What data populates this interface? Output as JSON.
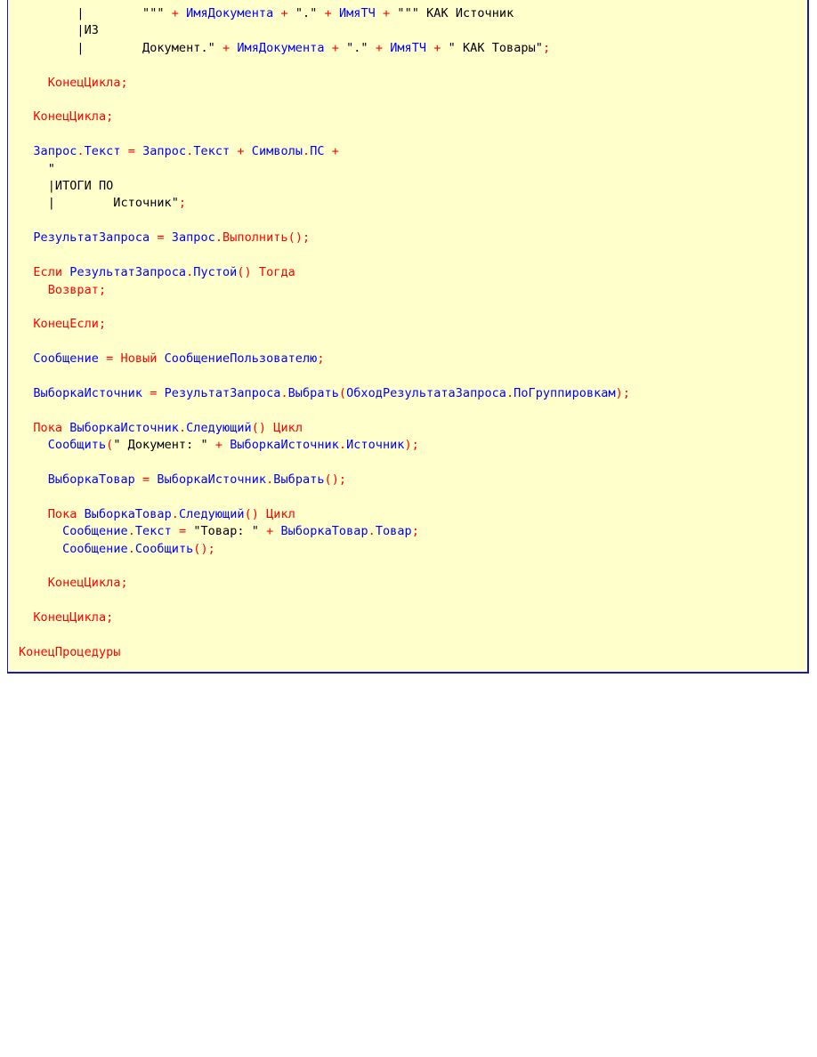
{
  "colors": {
    "background": "#ffffcc",
    "border": "#1a1ab8",
    "identifier": "#0000ff",
    "keyword": "#ff0000",
    "operator": "#ff0000",
    "string": "#000000"
  },
  "code_lines": [
    [
      [
        "ws",
        "        |        "
      ],
      [
        "str",
        "\"\"\""
      ],
      [
        "ws",
        " "
      ],
      [
        "op",
        "+"
      ],
      [
        "ws",
        " "
      ],
      [
        "id",
        "ИмяДокумента"
      ],
      [
        "ws",
        " "
      ],
      [
        "op",
        "+"
      ],
      [
        "ws",
        " "
      ],
      [
        "str",
        "\".\""
      ],
      [
        "ws",
        " "
      ],
      [
        "op",
        "+"
      ],
      [
        "ws",
        " "
      ],
      [
        "id",
        "ИмяТЧ"
      ],
      [
        "ws",
        " "
      ],
      [
        "op",
        "+"
      ],
      [
        "ws",
        " "
      ],
      [
        "str",
        "\"\"\" КАК Источник"
      ]
    ],
    [
      [
        "str",
        "        |ИЗ"
      ]
    ],
    [
      [
        "str",
        "        |        Документ.\""
      ],
      [
        "ws",
        " "
      ],
      [
        "op",
        "+"
      ],
      [
        "ws",
        " "
      ],
      [
        "id",
        "ИмяДокумента"
      ],
      [
        "ws",
        " "
      ],
      [
        "op",
        "+"
      ],
      [
        "ws",
        " "
      ],
      [
        "str",
        "\".\""
      ],
      [
        "ws",
        " "
      ],
      [
        "op",
        "+"
      ],
      [
        "ws",
        " "
      ],
      [
        "id",
        "ИмяТЧ"
      ],
      [
        "ws",
        " "
      ],
      [
        "op",
        "+"
      ],
      [
        "ws",
        " "
      ],
      [
        "str",
        "\" КАК Товары\""
      ],
      [
        "op",
        ";"
      ]
    ],
    [],
    [
      [
        "ws",
        "    "
      ],
      [
        "kw",
        "КонецЦикла"
      ],
      [
        "op",
        ";"
      ]
    ],
    [],
    [
      [
        "ws",
        "  "
      ],
      [
        "kw",
        "КонецЦикла"
      ],
      [
        "op",
        ";"
      ]
    ],
    [],
    [
      [
        "ws",
        "  "
      ],
      [
        "id",
        "Запрос"
      ],
      [
        "op",
        "."
      ],
      [
        "id",
        "Текст"
      ],
      [
        "ws",
        " "
      ],
      [
        "op",
        "="
      ],
      [
        "ws",
        " "
      ],
      [
        "id",
        "Запрос"
      ],
      [
        "op",
        "."
      ],
      [
        "id",
        "Текст"
      ],
      [
        "ws",
        " "
      ],
      [
        "op",
        "+"
      ],
      [
        "ws",
        " "
      ],
      [
        "id",
        "Символы"
      ],
      [
        "op",
        "."
      ],
      [
        "id",
        "ПС"
      ],
      [
        "ws",
        " "
      ],
      [
        "op",
        "+"
      ]
    ],
    [
      [
        "str",
        "    \""
      ]
    ],
    [
      [
        "str",
        "    |ИТОГИ ПО"
      ]
    ],
    [
      [
        "str",
        "    |        Источник\""
      ],
      [
        "op",
        ";"
      ]
    ],
    [],
    [
      [
        "ws",
        "  "
      ],
      [
        "id",
        "РезультатЗапроса"
      ],
      [
        "ws",
        " "
      ],
      [
        "op",
        "="
      ],
      [
        "ws",
        " "
      ],
      [
        "id",
        "Запрос"
      ],
      [
        "op",
        "."
      ],
      [
        "kw",
        "Выполнить"
      ],
      [
        "op",
        "();"
      ]
    ],
    [],
    [
      [
        "ws",
        "  "
      ],
      [
        "kw",
        "Если"
      ],
      [
        "ws",
        " "
      ],
      [
        "id",
        "РезультатЗапроса"
      ],
      [
        "op",
        "."
      ],
      [
        "id",
        "Пустой"
      ],
      [
        "op",
        "()"
      ],
      [
        "ws",
        " "
      ],
      [
        "kw",
        "Тогда"
      ]
    ],
    [
      [
        "ws",
        "    "
      ],
      [
        "kw",
        "Возврат"
      ],
      [
        "op",
        ";"
      ]
    ],
    [],
    [
      [
        "ws",
        "  "
      ],
      [
        "kw",
        "КонецЕсли"
      ],
      [
        "op",
        ";"
      ]
    ],
    [],
    [
      [
        "ws",
        "  "
      ],
      [
        "id",
        "Сообщение"
      ],
      [
        "ws",
        " "
      ],
      [
        "op",
        "="
      ],
      [
        "ws",
        " "
      ],
      [
        "kw",
        "Новый"
      ],
      [
        "ws",
        " "
      ],
      [
        "id",
        "СообщениеПользователю"
      ],
      [
        "op",
        ";"
      ]
    ],
    [],
    [
      [
        "ws",
        "  "
      ],
      [
        "id",
        "ВыборкаИсточник"
      ],
      [
        "ws",
        " "
      ],
      [
        "op",
        "="
      ],
      [
        "ws",
        " "
      ],
      [
        "id",
        "РезультатЗапроса"
      ],
      [
        "op",
        "."
      ],
      [
        "id",
        "Выбрать"
      ],
      [
        "op",
        "("
      ],
      [
        "id",
        "ОбходРезультатаЗапроса"
      ],
      [
        "op",
        "."
      ],
      [
        "id",
        "ПоГруппировкам"
      ],
      [
        "op",
        ");"
      ]
    ],
    [],
    [
      [
        "ws",
        "  "
      ],
      [
        "kw",
        "Пока"
      ],
      [
        "ws",
        " "
      ],
      [
        "id",
        "ВыборкаИсточник"
      ],
      [
        "op",
        "."
      ],
      [
        "id",
        "Следующий"
      ],
      [
        "op",
        "()"
      ],
      [
        "ws",
        " "
      ],
      [
        "kw",
        "Цикл"
      ]
    ],
    [
      [
        "ws",
        "    "
      ],
      [
        "id",
        "Сообщить"
      ],
      [
        "op",
        "("
      ],
      [
        "str",
        "\" Документ: \""
      ],
      [
        "ws",
        " "
      ],
      [
        "op",
        "+"
      ],
      [
        "ws",
        " "
      ],
      [
        "id",
        "ВыборкаИсточник"
      ],
      [
        "op",
        "."
      ],
      [
        "id",
        "Источник"
      ],
      [
        "op",
        ");"
      ]
    ],
    [],
    [
      [
        "ws",
        "    "
      ],
      [
        "id",
        "ВыборкаТовар"
      ],
      [
        "ws",
        " "
      ],
      [
        "op",
        "="
      ],
      [
        "ws",
        " "
      ],
      [
        "id",
        "ВыборкаИсточник"
      ],
      [
        "op",
        "."
      ],
      [
        "id",
        "Выбрать"
      ],
      [
        "op",
        "();"
      ]
    ],
    [],
    [
      [
        "ws",
        "    "
      ],
      [
        "kw",
        "Пока"
      ],
      [
        "ws",
        " "
      ],
      [
        "id",
        "ВыборкаТовар"
      ],
      [
        "op",
        "."
      ],
      [
        "id",
        "Следующий"
      ],
      [
        "op",
        "()"
      ],
      [
        "ws",
        " "
      ],
      [
        "kw",
        "Цикл"
      ]
    ],
    [
      [
        "ws",
        "      "
      ],
      [
        "id",
        "Сообщение"
      ],
      [
        "op",
        "."
      ],
      [
        "id",
        "Текст"
      ],
      [
        "ws",
        " "
      ],
      [
        "op",
        "="
      ],
      [
        "ws",
        " "
      ],
      [
        "str",
        "\"Товар: \""
      ],
      [
        "ws",
        " "
      ],
      [
        "op",
        "+"
      ],
      [
        "ws",
        " "
      ],
      [
        "id",
        "ВыборкаТовар"
      ],
      [
        "op",
        "."
      ],
      [
        "id",
        "Товар"
      ],
      [
        "op",
        ";"
      ]
    ],
    [
      [
        "ws",
        "      "
      ],
      [
        "id",
        "Сообщение"
      ],
      [
        "op",
        "."
      ],
      [
        "id",
        "Сообщить"
      ],
      [
        "op",
        "();"
      ]
    ],
    [],
    [
      [
        "ws",
        "    "
      ],
      [
        "kw",
        "КонецЦикла"
      ],
      [
        "op",
        ";"
      ]
    ],
    [],
    [
      [
        "ws",
        "  "
      ],
      [
        "kw",
        "КонецЦикла"
      ],
      [
        "op",
        ";"
      ]
    ],
    [],
    [
      [
        "kw",
        "КонецПроцедуры"
      ]
    ]
  ]
}
